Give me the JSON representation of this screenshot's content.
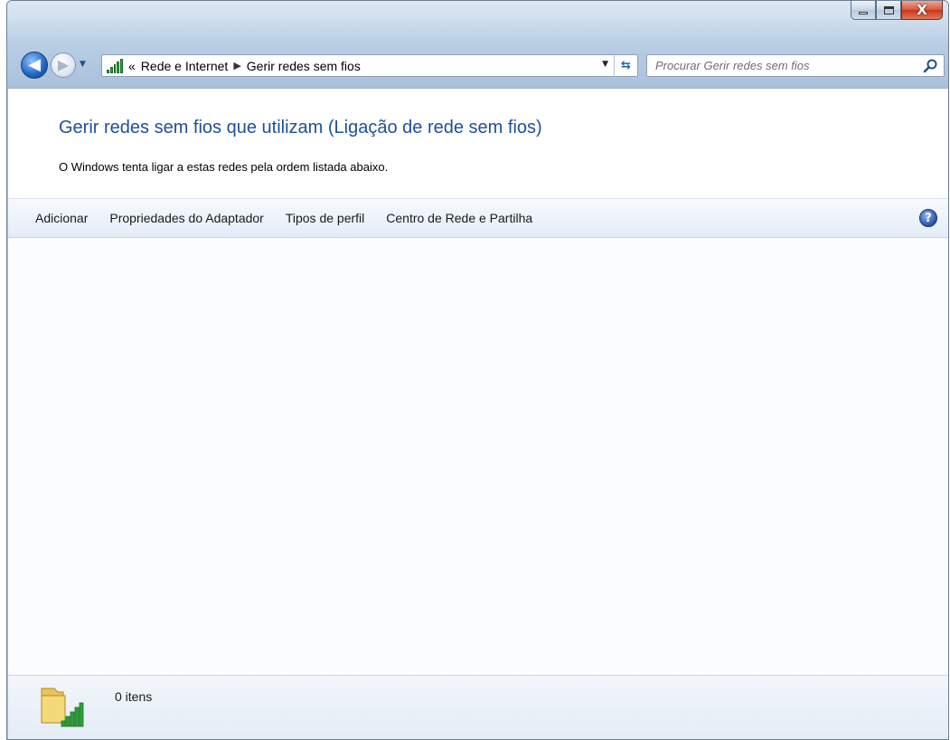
{
  "window": {
    "controls": {
      "minimize": "minimize",
      "maximize": "maximize",
      "close": "X"
    }
  },
  "nav": {
    "breadcrumb_prefix": "«",
    "breadcrumb": [
      "Rede e Internet",
      "Gerir redes sem fios"
    ],
    "search_placeholder": "Procurar Gerir redes sem fios"
  },
  "main": {
    "heading": "Gerir redes sem fios que utilizam (Ligação de rede sem fios)",
    "subtitle": "O Windows tenta ligar a estas redes pela ordem listada abaixo."
  },
  "toolbar": {
    "items": [
      "Adicionar",
      "Propriedades do Adaptador",
      "Tipos de perfil",
      "Centro de Rede e Partilha"
    ],
    "help": "?"
  },
  "status": {
    "count": "0 itens"
  },
  "colors": {
    "heading": "#1e4f9b",
    "signal_green": "#2aa53a"
  },
  "icons": [
    "back-arrow-icon",
    "forward-arrow-icon",
    "network-signal-icon",
    "refresh-icon",
    "search-icon",
    "help-icon",
    "folder-signal-icon"
  ]
}
